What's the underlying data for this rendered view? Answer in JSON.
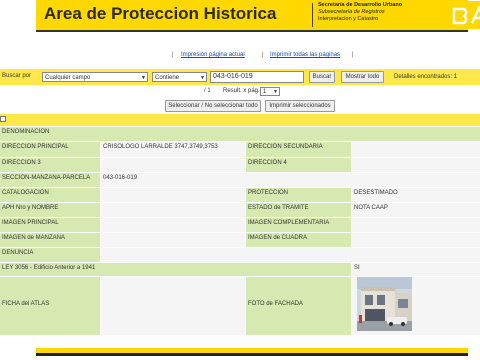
{
  "header": {
    "title": "Area de Proteccion Historica",
    "ministry_line1": "Secretaría de Desarrollo Urbano",
    "ministry_line2": "Subsecretaría de Registros",
    "ministry_line3": "Interpretacion y Catastro",
    "logo_text": "BA"
  },
  "links": {
    "print_page": "Impresión página actual",
    "print_all": "Imprimir todas las páginas"
  },
  "search": {
    "label": "Buscar por",
    "field_select": "Cualquier campo",
    "condition_select": "Contiene",
    "query_value": "043-016-019",
    "search_button": "Buscar",
    "show_all_button": "Mostrar todo",
    "found_text": "Detalles encontrados: 1"
  },
  "pager": {
    "page_info": "/ 1",
    "per_page_label": "Result. x pág.:",
    "per_page_value": "1"
  },
  "actions": {
    "select_toggle": "Seleccionar / No seleccionar todo",
    "print_selected": "Imprimir seleccionados"
  },
  "record": {
    "denominacion_label": "DENOMINACION",
    "dir_principal_label": "DIRECCION PRINCIPAL",
    "dir_principal_value": "CRISOLOGO LARRALDE 3747,3749,3753",
    "dir_secundaria_label": "DIRECCION SECUNDARIA",
    "dir3_label": "DIRECCION 3",
    "dir4_label": "DIRECCION 4",
    "smp_label": "SECCION-MANZANA-PARCELA",
    "smp_value": "043-016-019",
    "catalogacion_label": "CATALOGACION",
    "proteccion_label": "PROTECCION",
    "proteccion_value": "DESESTIMADO",
    "aph_label": "APH Nro y NOMBRE",
    "estado_label": "ESTADO de TRAMITE",
    "estado_value": "NOTA CAAP",
    "img_principal_label": "IMAGEN PRINCIPAL",
    "img_complementaria_label": "IMAGEN COMPLEMENTARIA",
    "img_manzana_label": "IMAGEN de MANZANA",
    "img_cuadra_label": "IMAGEN de CUADRA",
    "denuncia_label": "DENUNCIA",
    "ley_label": "LEY 3056 - Edificio Anterior a 1941",
    "ley_value": "SI",
    "ficha_label": "FICHA del ATLAS",
    "foto_label": "FOTO de FACHADA"
  },
  "colors": {
    "brand_yellow": "#FFD800",
    "bar_yellow": "#FFE94A",
    "label_green": "#D6E9B0"
  }
}
